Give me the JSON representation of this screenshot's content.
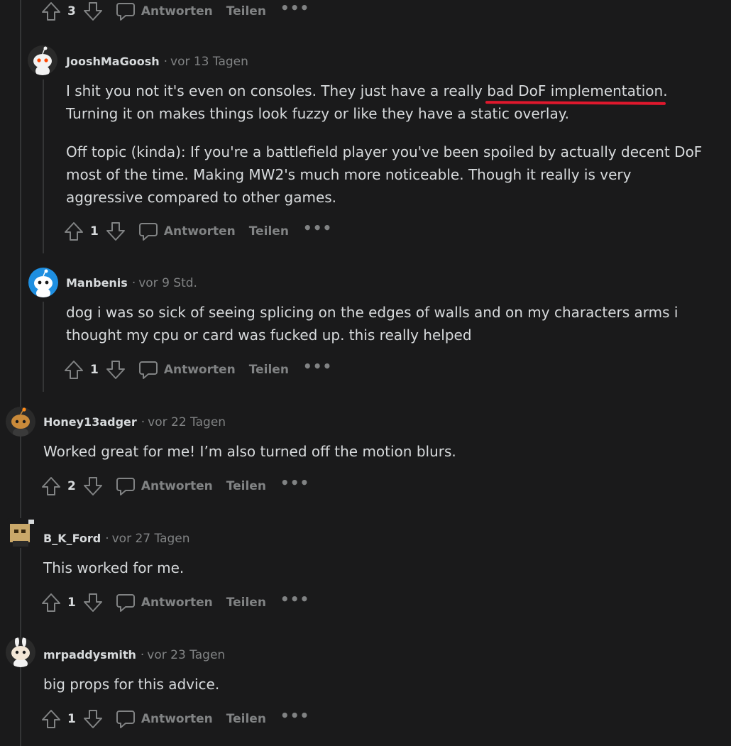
{
  "top_actions": {
    "score": "3",
    "reply_label": "Antworten",
    "share_label": "Teilen",
    "more_label": "•••"
  },
  "comments": [
    {
      "author": "JooshMaGoosh",
      "time": "vor 13 Tagen",
      "paragraphs": [
        {
          "before": "I shit you not it's even on consoles. They just have a really ",
          "highlight": "bad DoF implementation",
          "after": ". Turning it on makes things look fuzzy or like they have a static overlay."
        },
        {
          "text": "Off topic (kinda): If you're a battlefield player you've been spoiled by actually decent DoF most of the time. Making MW2's much more noticeable. Though it really is very aggressive compared to other games."
        }
      ],
      "score": "1",
      "reply_label": "Antworten",
      "share_label": "Teilen",
      "more_label": "•••"
    },
    {
      "author": "Manbenis",
      "time": "vor 9 Std.",
      "paragraphs": [
        {
          "text": "dog i was so sick of seeing splicing on the edges of walls and on my characters arms i thought my cpu or card was fucked up. this really helped"
        }
      ],
      "score": "1",
      "reply_label": "Antworten",
      "share_label": "Teilen",
      "more_label": "•••"
    },
    {
      "author": "Honey13adger",
      "time": "vor 22 Tagen",
      "paragraphs": [
        {
          "text": "Worked great for me! I’m also turned off the motion blurs."
        }
      ],
      "score": "2",
      "reply_label": "Antworten",
      "share_label": "Teilen",
      "more_label": "•••"
    },
    {
      "author": "B_K_Ford",
      "time": "vor 27 Tagen",
      "paragraphs": [
        {
          "text": "This worked for me."
        }
      ],
      "score": "1",
      "reply_label": "Antworten",
      "share_label": "Teilen",
      "more_label": "•••"
    },
    {
      "author": "mrpaddysmith",
      "time": "vor 23 Tagen",
      "paragraphs": [
        {
          "text": "big props for this advice."
        }
      ],
      "score": "1",
      "reply_label": "Antworten",
      "share_label": "Teilen",
      "more_label": "•••"
    }
  ],
  "separator": "·",
  "colors": {
    "background": "#1a1a1b",
    "text": "#d7dadc",
    "muted": "#818384",
    "thread_line": "#343536",
    "highlight_underline": "#e0182d"
  }
}
